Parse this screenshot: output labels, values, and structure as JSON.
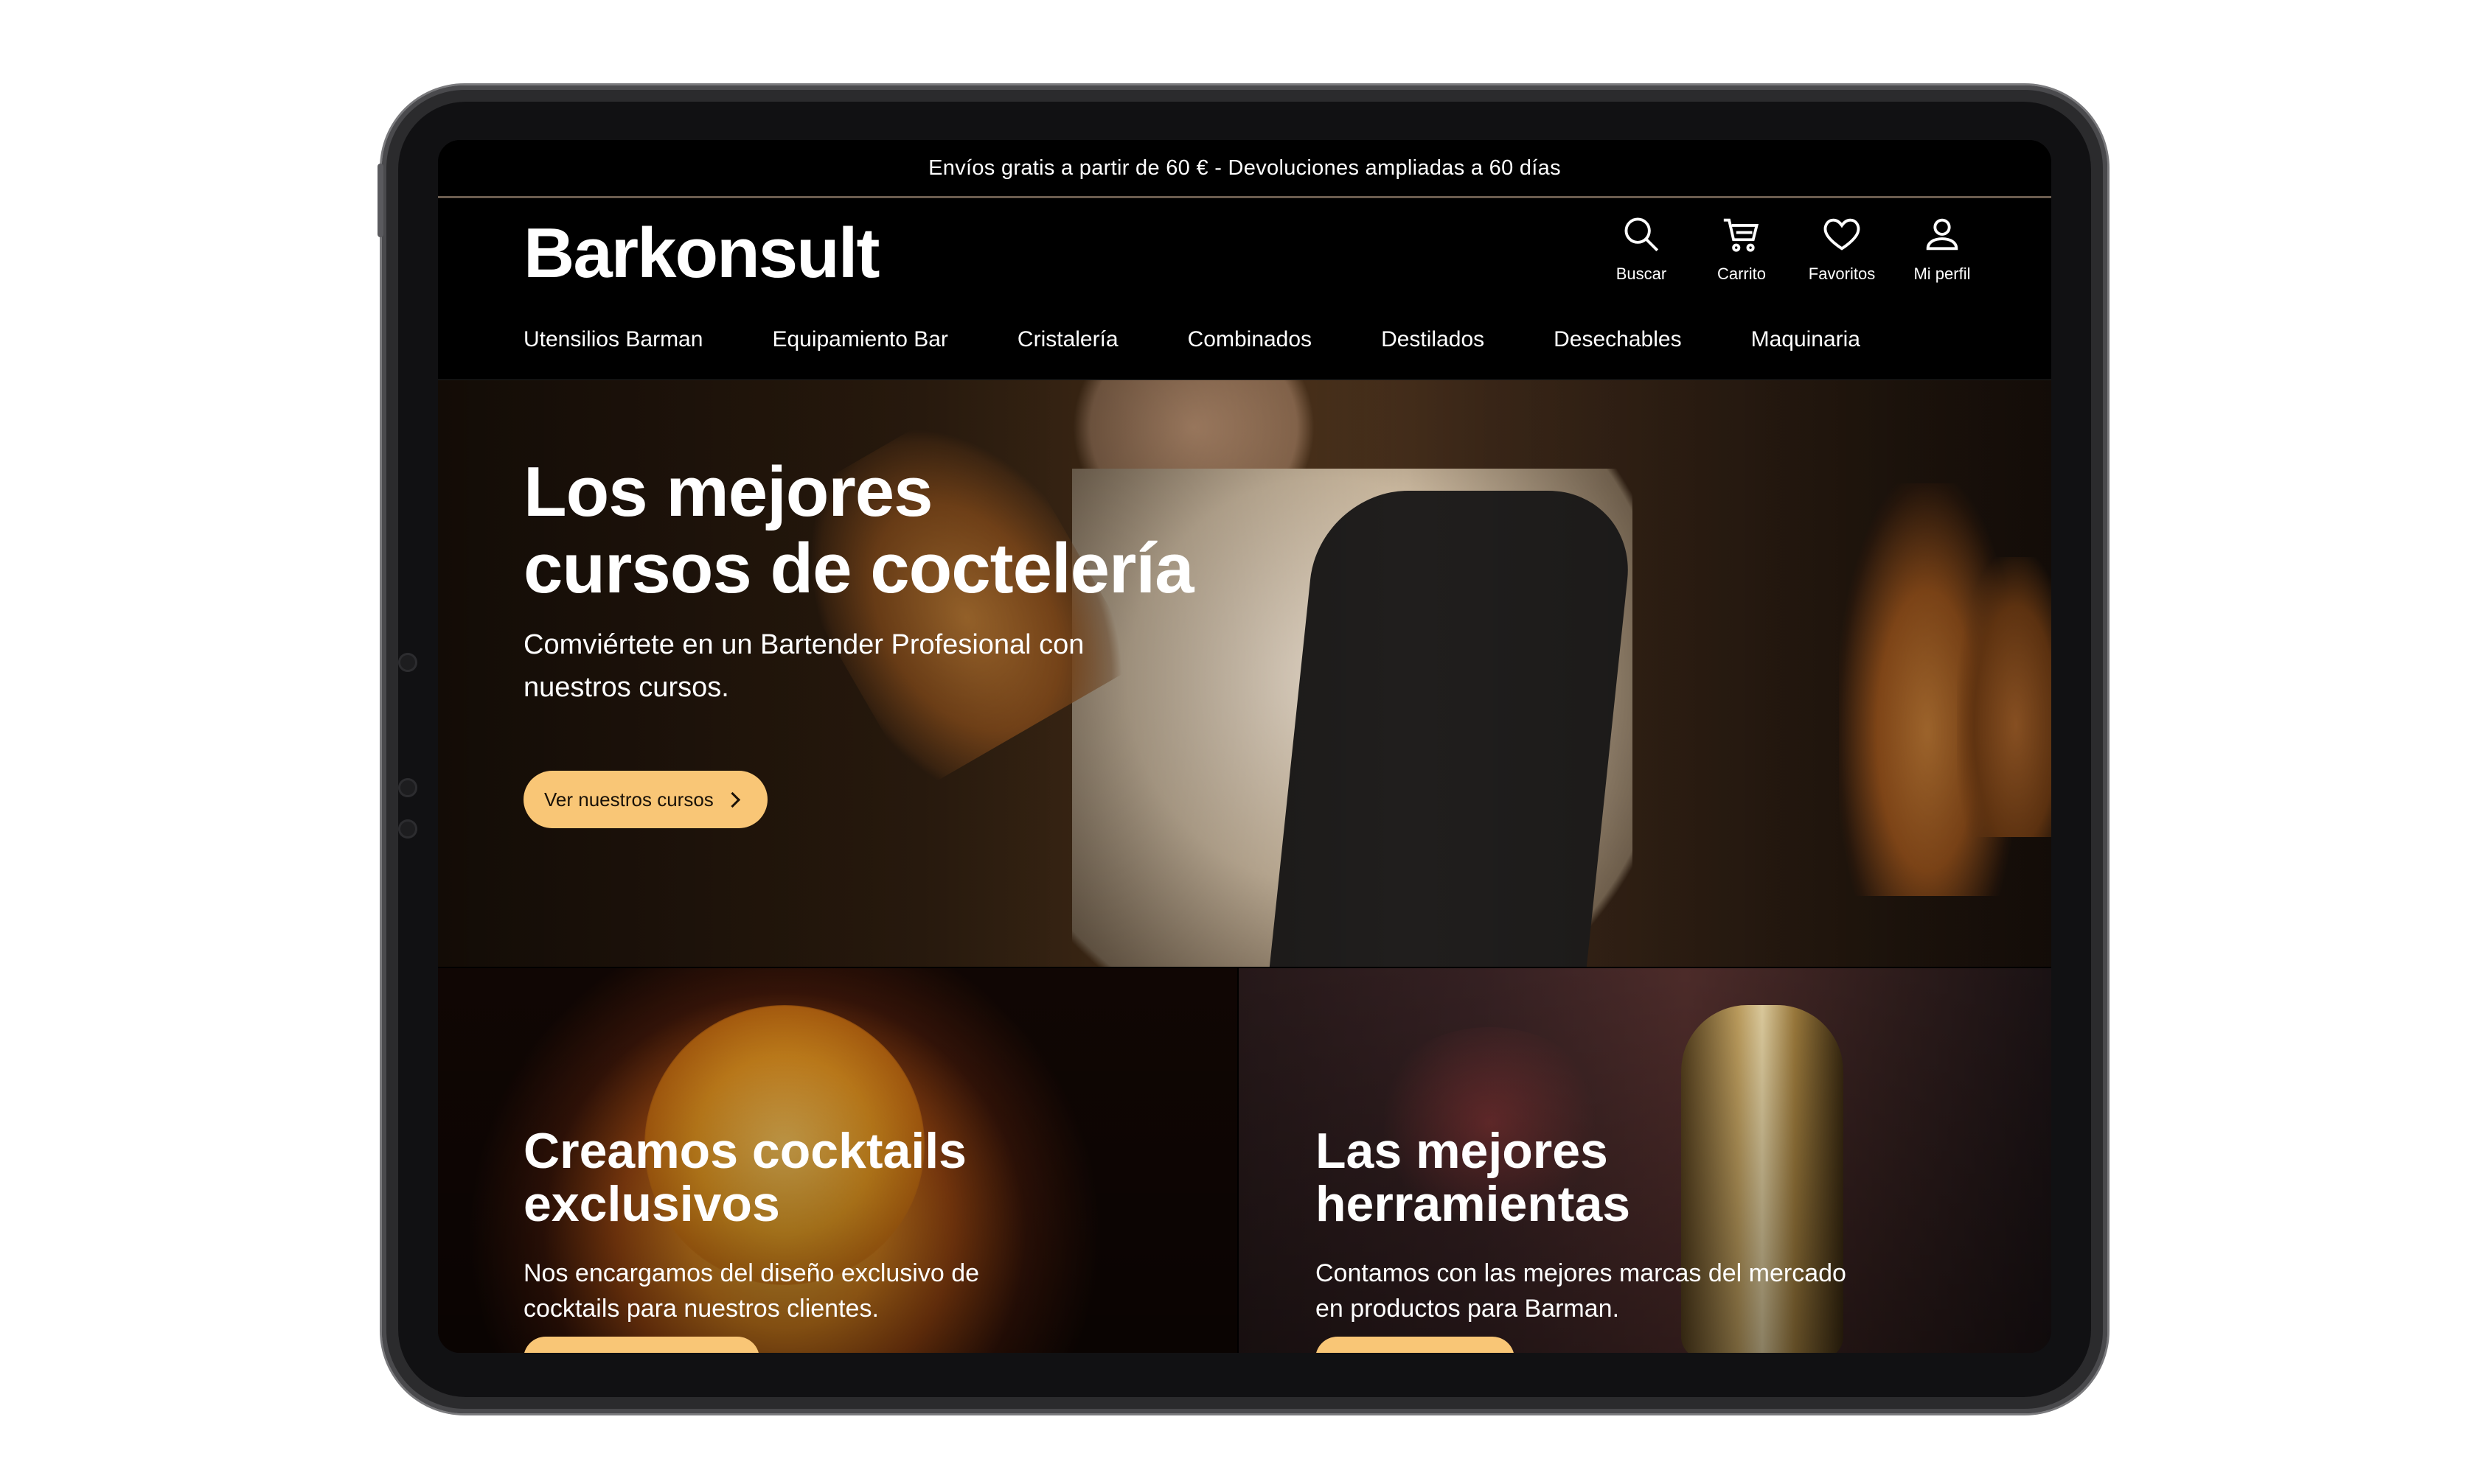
{
  "announcement": "Envíos gratis a partir de 60 € - Devoluciones ampliadas a 60 días",
  "brand": {
    "logo": "Barkonsult"
  },
  "header_icons": [
    {
      "icon": "search-icon",
      "label": "Buscar"
    },
    {
      "icon": "cart-icon",
      "label": "Carrito"
    },
    {
      "icon": "heart-icon",
      "label": "Favoritos"
    },
    {
      "icon": "user-icon",
      "label": "Mi perfil"
    }
  ],
  "nav": [
    "Utensilios Barman",
    "Equipamiento Bar",
    "Cristalería",
    "Combinados",
    "Destilados",
    "Desechables",
    "Maquinaria"
  ],
  "hero": {
    "title_line1": "Los mejores",
    "title_line2": "cursos de coctelería",
    "subtitle": "Comviértete en un Bartender Profesional con nuestros cursos.",
    "button": "Ver nuestros cursos"
  },
  "cards": [
    {
      "title_line1": "Creamos cocktails",
      "title_line2": "exclusivos",
      "text": "Nos encargamos del diseño exclusivo de cocktails para nuestros clientes."
    },
    {
      "title_line1": "Las mejores",
      "title_line2": "herramientas",
      "text": "Contamos con las mejores marcas del mercado en productos para Barman."
    }
  ],
  "colors": {
    "accent": "#f9c676",
    "background": "#000000",
    "text": "#ffffff"
  }
}
